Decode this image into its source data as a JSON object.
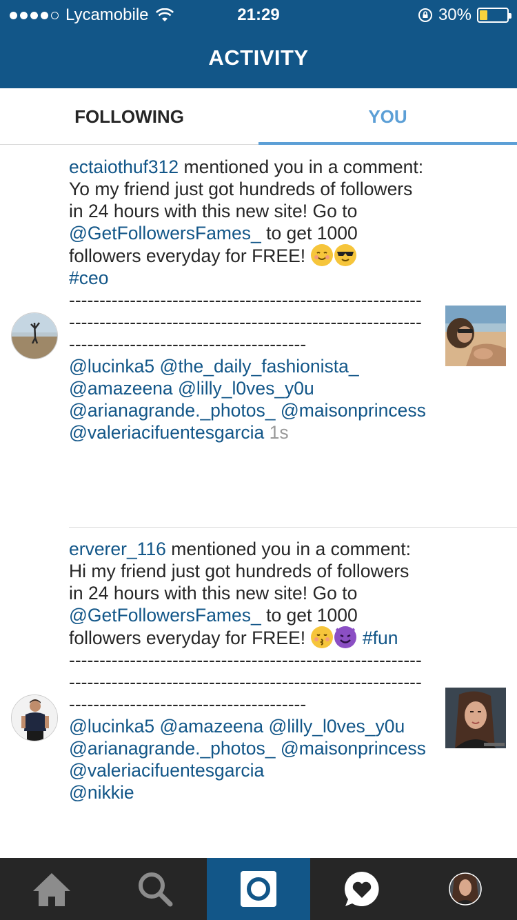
{
  "status_bar": {
    "carrier": "Lycamobile",
    "time": "21:29",
    "battery_percent": "30%",
    "battery_level": 0.3,
    "icons": [
      "signal-dots-icon",
      "wifi-icon",
      "rotation-lock-icon",
      "battery-icon"
    ]
  },
  "header": {
    "title": "ACTIVITY"
  },
  "tabs": {
    "following": "FOLLOWING",
    "you": "YOU",
    "active": "you"
  },
  "feed": [
    {
      "username": "ectaiothuf312",
      "body": " mentioned you in a comment: Yo my friend just got hundreds of followers in 24 hours with this new site! Go to ",
      "mention": "@GetFollowersFames_",
      "body2": " to get 1000 followers everyday for FREE! ",
      "emojis": [
        "smiling-face-emoji",
        "sunglasses-face-emoji"
      ],
      "hashtag": "#ceo",
      "dashes": "-----------------------------------------------------------------------------------------------------------------------------------------------------------",
      "tagged": "@lucinka5 @the_daily_fashionista_ @amazeena @lilly_l0ves_y0u @arianagrande._photos_ @maisonprincess @valeriacifuentesgarcia",
      "timestamp": "1s"
    },
    {
      "username": "erverer_116",
      "body": " mentioned you in a comment: Hi my friend just got hundreds of followers in 24 hours with this new site! Go to ",
      "mention": "@GetFollowersFames_",
      "body2": " to get 1000 followers everyday for FREE! ",
      "emojis": [
        "kissing-face-emoji",
        "smiling-devil-emoji"
      ],
      "hashtag": "#fun",
      "dashes": "-----------------------------------------------------------------------------------------------------------------------------------------------------------",
      "tagged": "@lucinka5 @amazeena @lilly_l0ves_y0u @arianagrande._photos_ @maisonprincess @valeriacifuentesgarcia",
      "tagged_cut": "@nikkie"
    }
  ],
  "tabbar": {
    "items": [
      "home-icon",
      "search-icon",
      "camera-icon",
      "activity-heart-icon",
      "profile-avatar"
    ],
    "active_index": 2
  },
  "colors": {
    "brand_blue": "#125688",
    "tab_active": "#5c9fd6",
    "tabbar_bg": "#262626",
    "link": "#125688"
  }
}
